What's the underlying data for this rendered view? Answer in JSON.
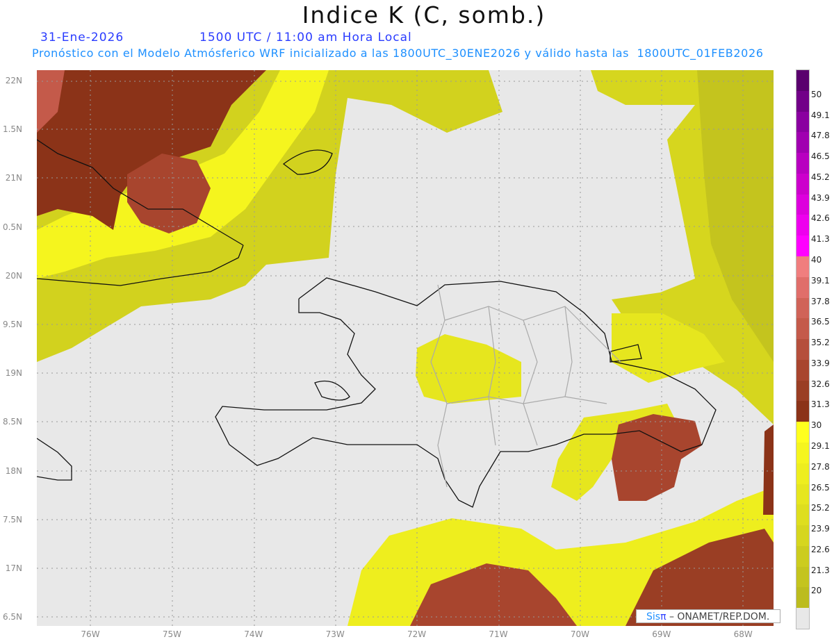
{
  "header": {
    "title": "Indice K (C, somb.)",
    "date": "31-Ene-2026",
    "time": "1500 UTC / 11:00 am Hora Local",
    "forecast": "Pronóstico con el Modelo Atmósferico WRF inicializado a las 1800UTC_30ENE2026 y válido hasta las  1800UTC_01FEB2026"
  },
  "axes": {
    "lat_labels": [
      "22N",
      "1.5N",
      "21N",
      "0.5N",
      "20N",
      "9.5N",
      "19N",
      "8.5N",
      "18N",
      "7.5N",
      "17N",
      "6.5N"
    ],
    "lon_labels": [
      "76W",
      "75W",
      "74W",
      "73W",
      "72W",
      "71W",
      "70W",
      "69W",
      "68W"
    ]
  },
  "colorbar": {
    "labels": [
      "50",
      "49.1",
      "47.8",
      "46.5",
      "45.2",
      "43.9",
      "42.6",
      "41.3",
      "40",
      "39.1",
      "37.8",
      "36.5",
      "35.2",
      "33.9",
      "32.6",
      "31.3",
      "30",
      "29.1",
      "27.8",
      "26.5",
      "25.2",
      "23.9",
      "22.6",
      "21.3",
      "20"
    ],
    "colors": [
      "#5a006e",
      "#720088",
      "#8a00a0",
      "#a000b0",
      "#b800c0",
      "#cc00cc",
      "#dd00dd",
      "#ee00ee",
      "#ff00ff",
      "#f07e7e",
      "#e06e6a",
      "#d06358",
      "#c45a4a",
      "#b54f3c",
      "#a8452e",
      "#9a3e24",
      "#8b3318",
      "#ffff1e",
      "#f5f51e",
      "#eeee1e",
      "#e6e61e",
      "#dede1e",
      "#d6d61e",
      "#cccc1e",
      "#c4c41e",
      "#bcbc1e",
      "#e8e8e8"
    ]
  },
  "logo": {
    "sis": "Sis",
    "pi": "π",
    "rest": " – ONAMET/REP.DOM."
  }
}
